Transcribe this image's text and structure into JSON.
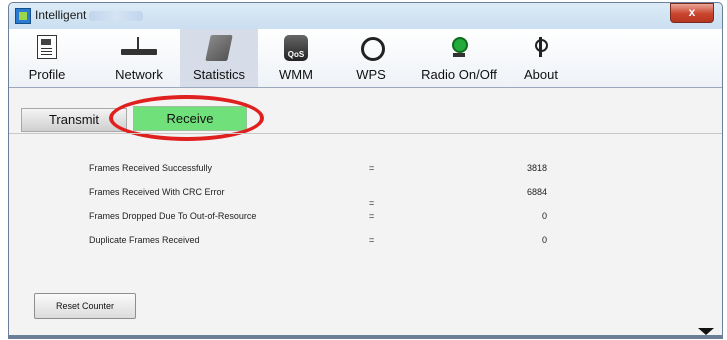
{
  "window": {
    "title": "Intelligent",
    "close_label": "x"
  },
  "toolbar": {
    "items": [
      {
        "label": "Profile",
        "icon": "profile-icon"
      },
      {
        "label": "Network",
        "icon": "network-icon"
      },
      {
        "label": "Statistics",
        "icon": "statistics-icon",
        "active": true
      },
      {
        "label": "WMM",
        "icon": "wmm-icon",
        "icon_text": "QoS"
      },
      {
        "label": "WPS",
        "icon": "wps-icon"
      },
      {
        "label": "Radio On/Off",
        "icon": "radio-icon"
      },
      {
        "label": "About",
        "icon": "about-icon"
      }
    ]
  },
  "tabs": {
    "transmit": "Transmit",
    "receive": "Receive"
  },
  "stats": [
    {
      "label": "Frames Received Successfully",
      "eq": "=",
      "value": "3818"
    },
    {
      "label": "Frames Received With CRC Error",
      "eq": "",
      "value": "6884"
    },
    {
      "label": "Frames Dropped Due To Out-of-Resource",
      "eq": "=",
      "value": "0"
    },
    {
      "label": "Duplicate Frames Received",
      "eq": "=",
      "value": "0"
    }
  ],
  "stray_eq": "=",
  "reset_button": "Reset Counter",
  "colors": {
    "receive_tab": "#6fe07a",
    "highlight_oval": "#e01f1f",
    "close_button": "#c8442d"
  }
}
